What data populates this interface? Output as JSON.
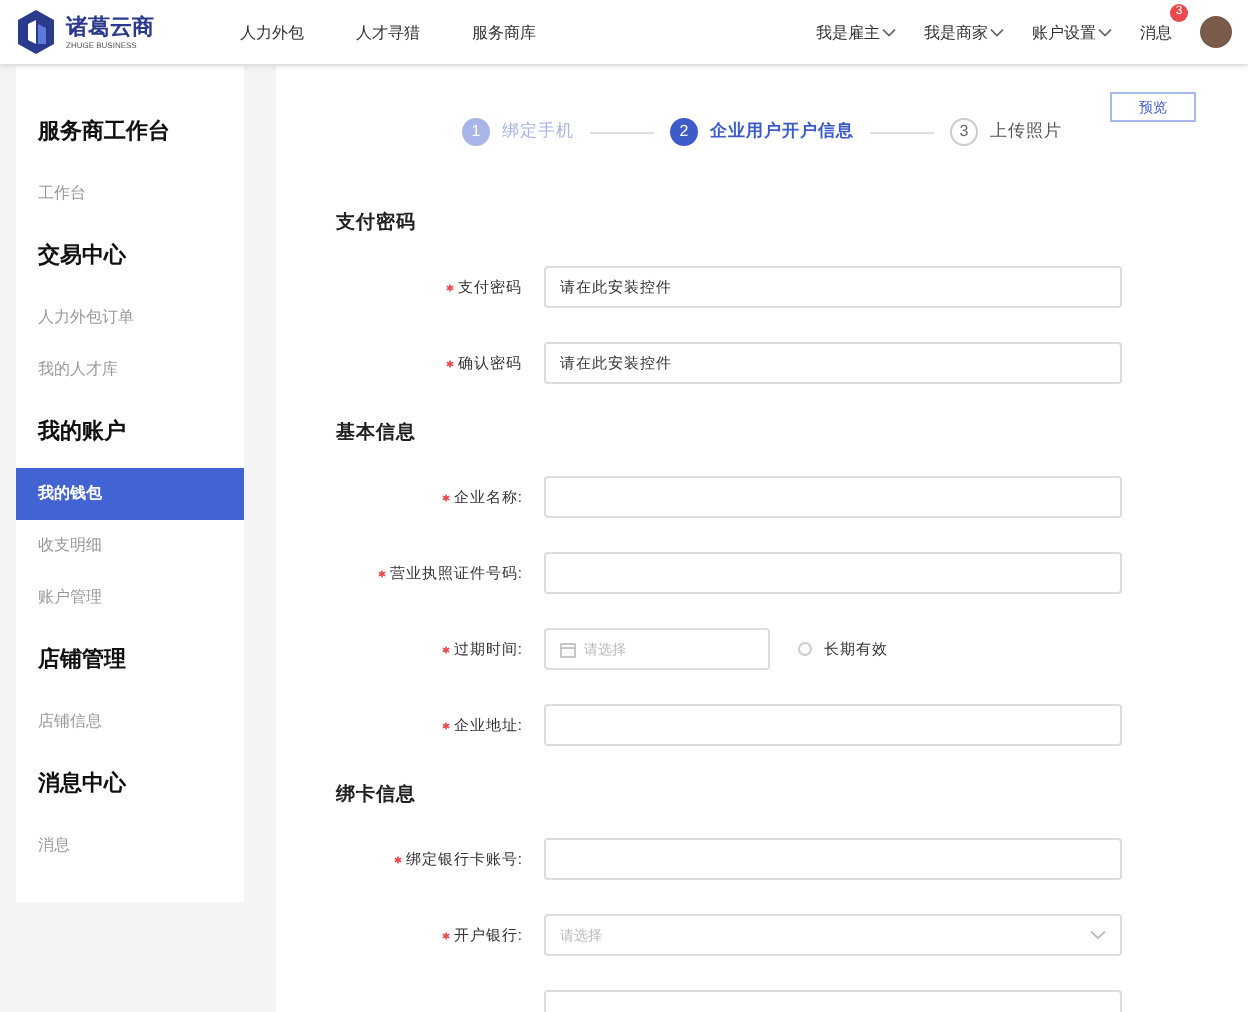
{
  "header": {
    "logo": {
      "name": "诸葛云商",
      "tagline": "ZHUGE BUSINESS"
    },
    "nav": [
      {
        "label": "人力外包"
      },
      {
        "label": "人才寻猎"
      },
      {
        "label": "服务商库"
      }
    ],
    "menus": [
      {
        "label": "我是雇主",
        "kind": "dropdown"
      },
      {
        "label": "我是商家",
        "kind": "dropdown"
      },
      {
        "label": "账户设置",
        "kind": "dropdown"
      },
      {
        "label": "消息",
        "kind": "badge",
        "badge": "3"
      }
    ]
  },
  "sidebar": {
    "groups": [
      {
        "title": "服务商工作台",
        "items": [
          {
            "label": "工作台",
            "selected": false
          }
        ]
      },
      {
        "title": "交易中心",
        "items": [
          {
            "label": "人力外包订单",
            "selected": false
          },
          {
            "label": "我的人才库",
            "selected": false
          }
        ]
      },
      {
        "title": "我的账户",
        "items": [
          {
            "label": "我的钱包",
            "selected": true
          },
          {
            "label": "收支明细",
            "selected": false
          },
          {
            "label": "账户管理",
            "selected": false
          }
        ]
      },
      {
        "title": "店铺管理",
        "items": [
          {
            "label": "店铺信息",
            "selected": false
          }
        ]
      },
      {
        "title": "消息中心",
        "items": [
          {
            "label": "消息",
            "selected": false
          }
        ]
      }
    ]
  },
  "steps": [
    {
      "number": "1",
      "label": "绑定手机",
      "completed": true,
      "selected": false
    },
    {
      "number": "2",
      "label": "企业用户开户信息",
      "completed": false,
      "selected": true
    },
    {
      "number": "3",
      "label": "上传照片",
      "completed": false,
      "selected": false
    }
  ],
  "preview_button": "预览",
  "sections": [
    {
      "title": "支付密码",
      "fields": [
        {
          "label": "支付密码",
          "required": true,
          "kind": "input",
          "value": "请在此安装控件"
        },
        {
          "label": "确认密码",
          "required": true,
          "kind": "input",
          "value": "请在此安装控件"
        }
      ]
    },
    {
      "title": "基本信息",
      "fields": [
        {
          "label": "企业名称:",
          "required": true,
          "kind": "input"
        },
        {
          "label": "营业执照证件号码:",
          "required": true,
          "kind": "input"
        },
        {
          "label": "过期时间:",
          "required": true,
          "kind": "date",
          "placeholder": "请选择",
          "option": {
            "label": "长期有效",
            "checked": false
          }
        },
        {
          "label": "企业地址:",
          "required": true,
          "kind": "input"
        }
      ]
    },
    {
      "title": "绑卡信息",
      "fields": [
        {
          "label": "绑定银行卡账号:",
          "required": true,
          "kind": "input"
        },
        {
          "label": "开户银行:",
          "required": true,
          "kind": "select",
          "placeholder": "请选择"
        },
        {
          "required": false,
          "kind": "input"
        }
      ]
    }
  ]
}
